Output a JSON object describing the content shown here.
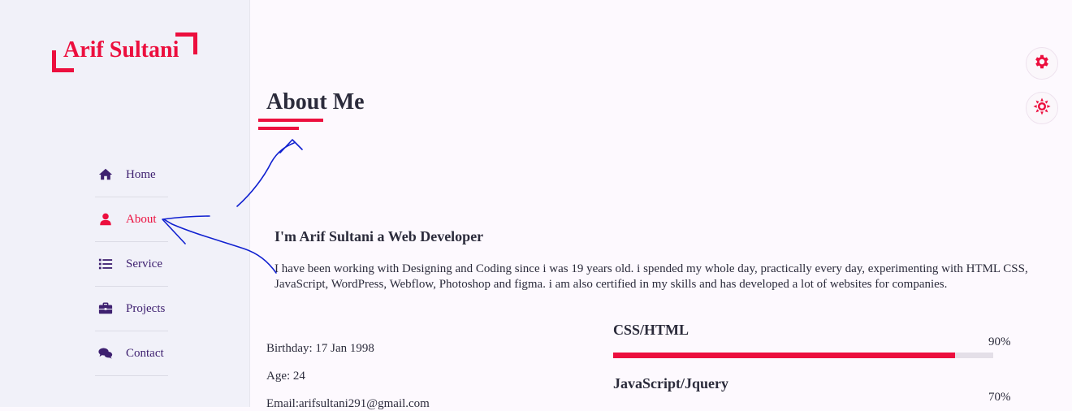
{
  "brand": {
    "name": "Arif Sultani",
    "color": "#ec0f3e"
  },
  "sidebar": {
    "items": [
      {
        "label": "Home",
        "icon": "home-icon"
      },
      {
        "label": "About",
        "icon": "user-icon",
        "active": true
      },
      {
        "label": "Service",
        "icon": "list-icon"
      },
      {
        "label": "Projects",
        "icon": "briefcase-icon"
      },
      {
        "label": "Contact",
        "icon": "chat-icon"
      }
    ]
  },
  "settings": [
    {
      "icon": "gear-icon"
    },
    {
      "icon": "sun-icon"
    }
  ],
  "main": {
    "title": "About Me",
    "subheading": "I'm Arif Sultani a Web Developer",
    "description": "I have been working with Designing and Coding since i was 19 years old. i spended my whole day, practically every day, experimenting with HTML CSS, JavaScript, WordPress, Webflow, Photoshop and figma. i am also certified in my skills and has developed a lot of websites for companies.",
    "info": {
      "birthday": "Birthday: 17 Jan 1998",
      "age": "Age: 24",
      "email": "Email:arifsultani291@gmail.com"
    },
    "skills": [
      {
        "name": "CSS/HTML",
        "percent_label": "90%",
        "level": 0.9
      },
      {
        "name": "JavaScript/Jquery",
        "percent_label": "70%",
        "level": 0.7
      }
    ]
  },
  "colors": {
    "accent": "#ec0f3e",
    "nav": "#3e2070",
    "annotation": "#1020d0"
  }
}
